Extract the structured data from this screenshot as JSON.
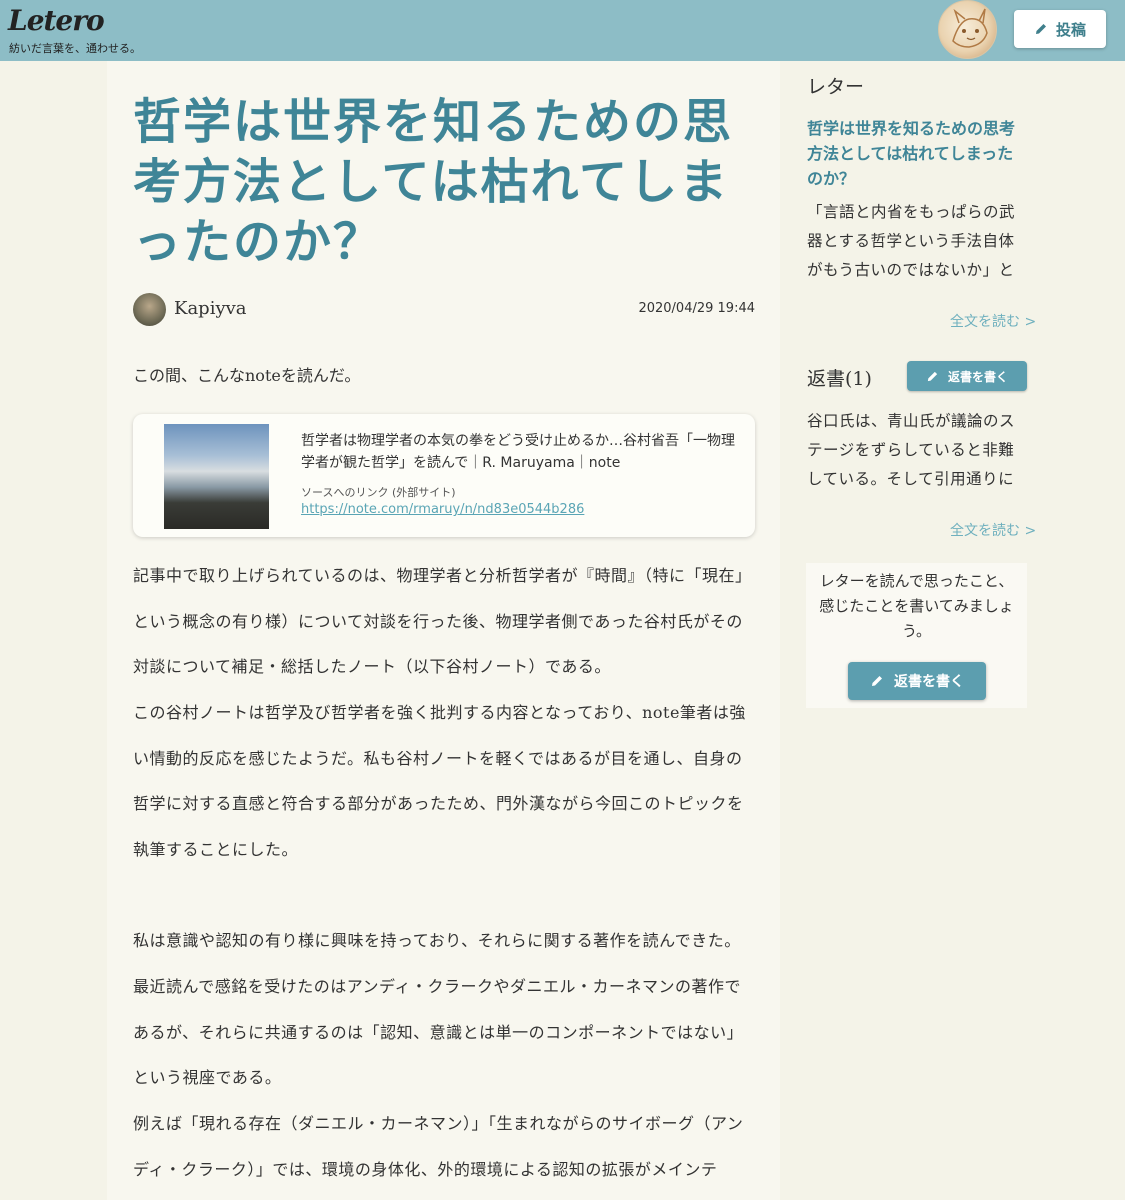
{
  "header": {
    "logo": "Letero",
    "tagline": "紡いだ言葉を、通わせる。",
    "post_button_label": "投稿",
    "icons": {
      "post": "pencil-icon"
    }
  },
  "article": {
    "title": "哲学は世界を知るための思考方法としては枯れてしまったのか？",
    "author": "Kapiyva",
    "date": "2020/04/29 19:44",
    "intro": "この間、こんなnoteを読んだ。",
    "link_card": {
      "title": "哲学者は物理学者の本気の拳をどう受け止めるか…谷村省吾「一物理学者が観た哲学」を読んで｜R. Maruyama｜note",
      "source_label": "ソースへのリンク (外部サイト)",
      "url": "https://note.com/rmaruy/n/nd83e0544b286"
    },
    "paragraphs": [
      "記事中で取り上げられているのは、物理学者と分析哲学者が『時間』（特に「現在」という概念の有り様）について対談を行った後、物理学者側であった谷村氏がその対談について補足・総括したノート（以下谷村ノート）である。",
      "この谷村ノートは哲学及び哲学者を強く批判する内容となっており、note筆者は強い情動的反応を感じたようだ。私も谷村ノートを軽くではあるが目を通し、自身の哲学に対する直感と符合する部分があったため、門外漢ながら今回このトピックを執筆することにした。",
      "私は意識や認知の有り様に興味を持っており、それらに関する著作を読んできた。",
      "最近読んで感銘を受けたのはアンディ・クラークやダニエル・カーネマンの著作であるが、それらに共通するのは「認知、意識とは単一のコンポーネントではない」という視座である。",
      "例えば「現れる存在（ダニエル・カーネマン）」「生まれながらのサイボーグ（アンディ・クラーク）」では、環境の身体化、外的環境による認知の拡張がメインテ"
    ]
  },
  "sidebar": {
    "letter_heading": "レター",
    "letter_title": "哲学は世界を知るための思考方法としては枯れてしまったのか？",
    "letter_excerpt": "「言語と内省をもっぱらの武器とする哲学という手法自体がもう古いのではないか」と",
    "read_more_1": "全文を読む >",
    "replies_heading": "返書(1)",
    "reply_small_button": "返書を書く",
    "reply_excerpt": "谷口氏は、青山氏が議論のステージをずらしていると非難している。そして引用通りに",
    "read_more_2": "全文を読む >",
    "prompt_text": "レターを読んで思ったこと、感じたことを書いてみましょう。",
    "reply_big_button": "返書を書く"
  },
  "colors": {
    "header_bg": "#8dbdc6",
    "accent": "#3f8597",
    "button_bg": "#5c9eaf",
    "link": "#5aa5b5"
  }
}
